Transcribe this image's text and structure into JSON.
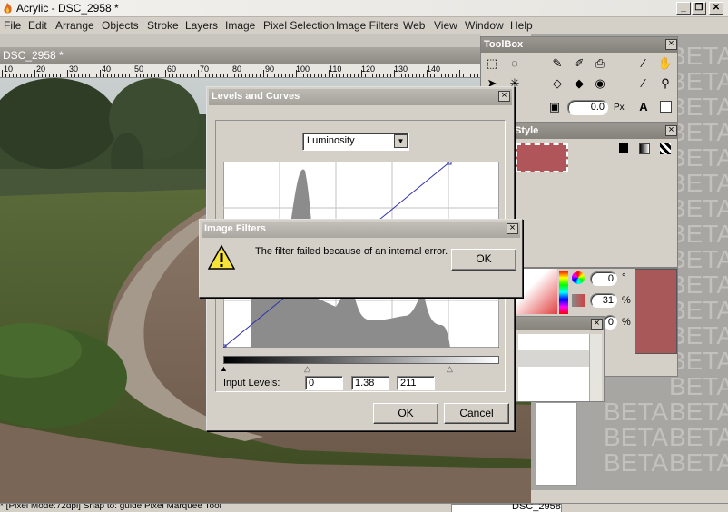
{
  "app": {
    "title": "Acrylic - DSC_2958 *"
  },
  "menu": [
    "File",
    "Edit",
    "Arrange",
    "Objects",
    "Stroke",
    "Layers",
    "Image",
    "Pixel Selection",
    "Image Filters",
    "Web",
    "View",
    "Window",
    "Help"
  ],
  "document": {
    "tab_title": "DSC_2958 *",
    "ruler_labels": [
      "10",
      "20",
      "30",
      "40",
      "50",
      "60",
      "70",
      "80",
      "90",
      "100",
      "110",
      "120",
      "130",
      "140"
    ]
  },
  "beta_text": "BETA",
  "toolbox": {
    "title": "ToolBox",
    "size_value": "0.0",
    "size_unit": "Px"
  },
  "style_panel": {
    "title": "Style",
    "fill_color": "#b0565a"
  },
  "color_panel": {
    "value1": "0",
    "unit1": "°",
    "value2": "31",
    "unit2": "%",
    "value3": "0",
    "unit3": "%",
    "swatch_color": "#a85858"
  },
  "levels_dialog": {
    "title": "Levels and Curves",
    "channel": "Luminosity",
    "input_levels_label": "Input Levels:",
    "input_low": "0",
    "input_gamma": "1.38",
    "input_high": "211",
    "ok_label": "OK",
    "cancel_label": "Cancel"
  },
  "error_dialog": {
    "title": "Image Filters",
    "message": "The filter failed because of an internal error.",
    "ok_label": "OK"
  },
  "statusbar": {
    "left_text": "* [Pixel Mode:72dpi] Snap to: guide     Pixel Marquee Tool",
    "doc_name": "DSC_2958"
  },
  "colors": {
    "accent": "#b0565a",
    "title_gray": "#9a9791",
    "graph_fill": "#8c8c8c"
  }
}
